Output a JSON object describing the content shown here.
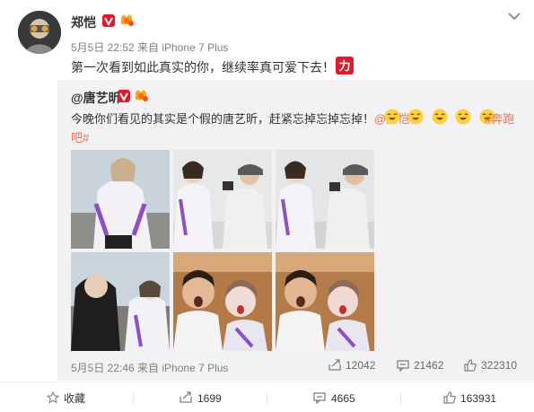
{
  "post": {
    "author": "郑恺",
    "meta": "5月5日 22:52 来自 iPhone 7 Plus",
    "text": "第一次看到如此真实的你，继续率真可爱下去！",
    "text_emoji": "力"
  },
  "repost": {
    "author": "@唐艺昕",
    "text_line1": "今晚你们看见的其实是个假的唐艺昕，赶紧忘掉忘掉忘掉！",
    "mention": "@郑恺",
    "hashtag_line1": "#奔跑",
    "hashtag_line2": "吧#",
    "meta": "5月5日 22:46 来自 iPhone 7 Plus",
    "repost_count": "12042",
    "comment_count": "21462",
    "like_count": "322310"
  },
  "actions": {
    "favorite_label": "收藏",
    "repost_count": "1699",
    "comment_count": "4665",
    "like_count": "163931"
  },
  "colors": {
    "link": "#eb7350",
    "verified": "#e6162d",
    "repost_bg": "#f2f2f5",
    "meta": "#808080"
  },
  "icons": [
    "verified-badge-icon",
    "level-badge-icon",
    "dropdown-caret-icon",
    "li-emoji-icon",
    "laugh-emoji-icon",
    "favorite-icon",
    "repost-icon",
    "comment-icon",
    "like-icon"
  ]
}
